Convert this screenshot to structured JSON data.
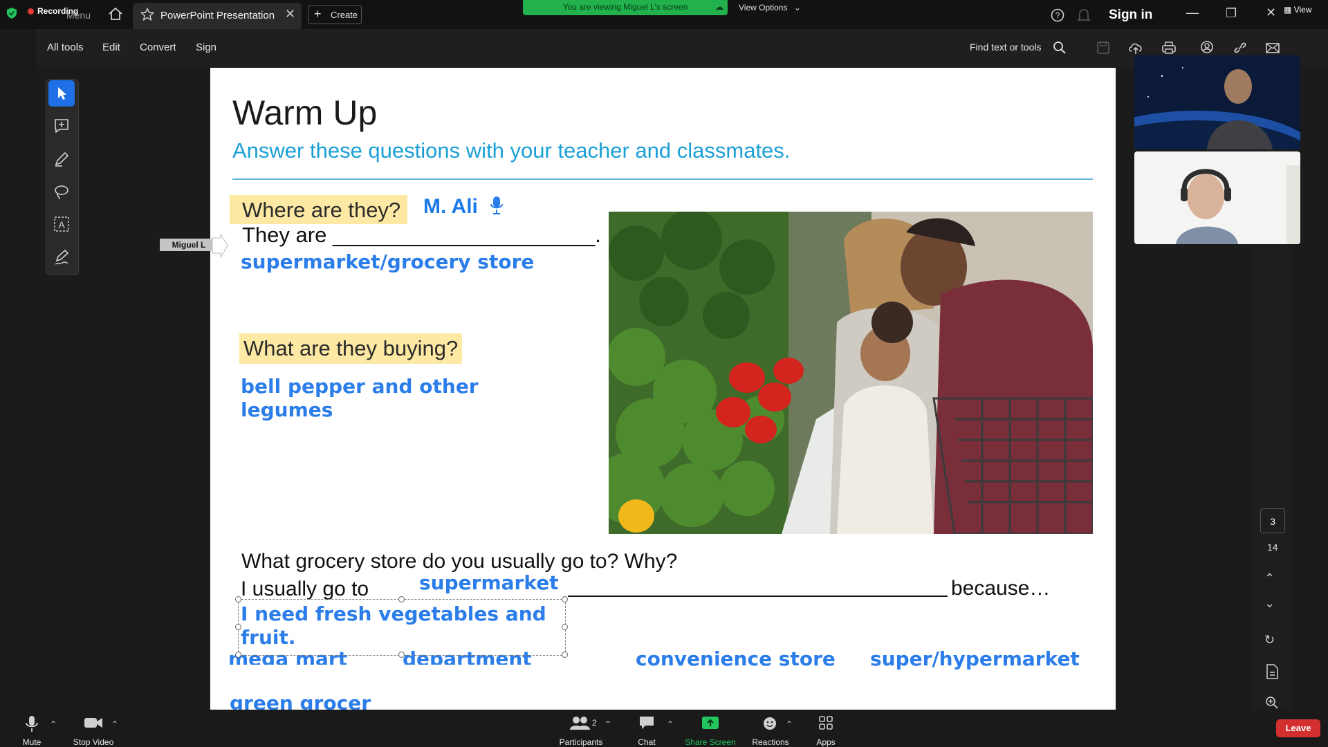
{
  "titlebar": {
    "recording_label": "Recording",
    "menu_label": "Menu",
    "tab_title": "PowerPoint Presentation",
    "create_label": "Create",
    "viewing_banner": "You are viewing Miguel L's screen",
    "view_options": "View Options",
    "sign_in": "Sign in",
    "view_label": "View"
  },
  "toolbar": {
    "menus": [
      "All tools",
      "Edit",
      "Convert",
      "Sign"
    ],
    "find_label": "Find text or tools"
  },
  "annotation": {
    "presenter_tag": "Miguel L"
  },
  "slide": {
    "title": "Warm Up",
    "subtitle": "Answer these questions with your teacher and classmates.",
    "q1": "Where are they?",
    "presenter": "M. Ali",
    "q1_prompt": "They are ______________________.",
    "a1": "supermarket/grocery store",
    "q2": "What are they buying?",
    "a2": "bell pepper and other legumes",
    "q3": "What grocery store do you usually go to? Why?",
    "q3_prompt": "I usually go to",
    "because": "because…",
    "a3": "supermarket",
    "a4": "I need fresh vegetables and fruit.",
    "options": [
      "mega mart",
      "department store",
      "convenience store",
      "super/hypermarket",
      "green grocer"
    ]
  },
  "pages": {
    "current": "3",
    "total": "14"
  },
  "bottom": {
    "mute": "Mute",
    "stop_video": "Stop Video",
    "participants": "Participants",
    "participant_count": "2",
    "chat": "Chat",
    "share_screen": "Share Screen",
    "reactions": "Reactions",
    "apps": "Apps",
    "leave": "Leave"
  },
  "colors": {
    "accent_blue": "#1f6fe6",
    "answer_blue": "#2b7de9",
    "subtitle_blue": "#1ba0d6",
    "highlight": "#fde9a3",
    "share_green": "#22b14c",
    "leave_red": "#d32f2f"
  }
}
